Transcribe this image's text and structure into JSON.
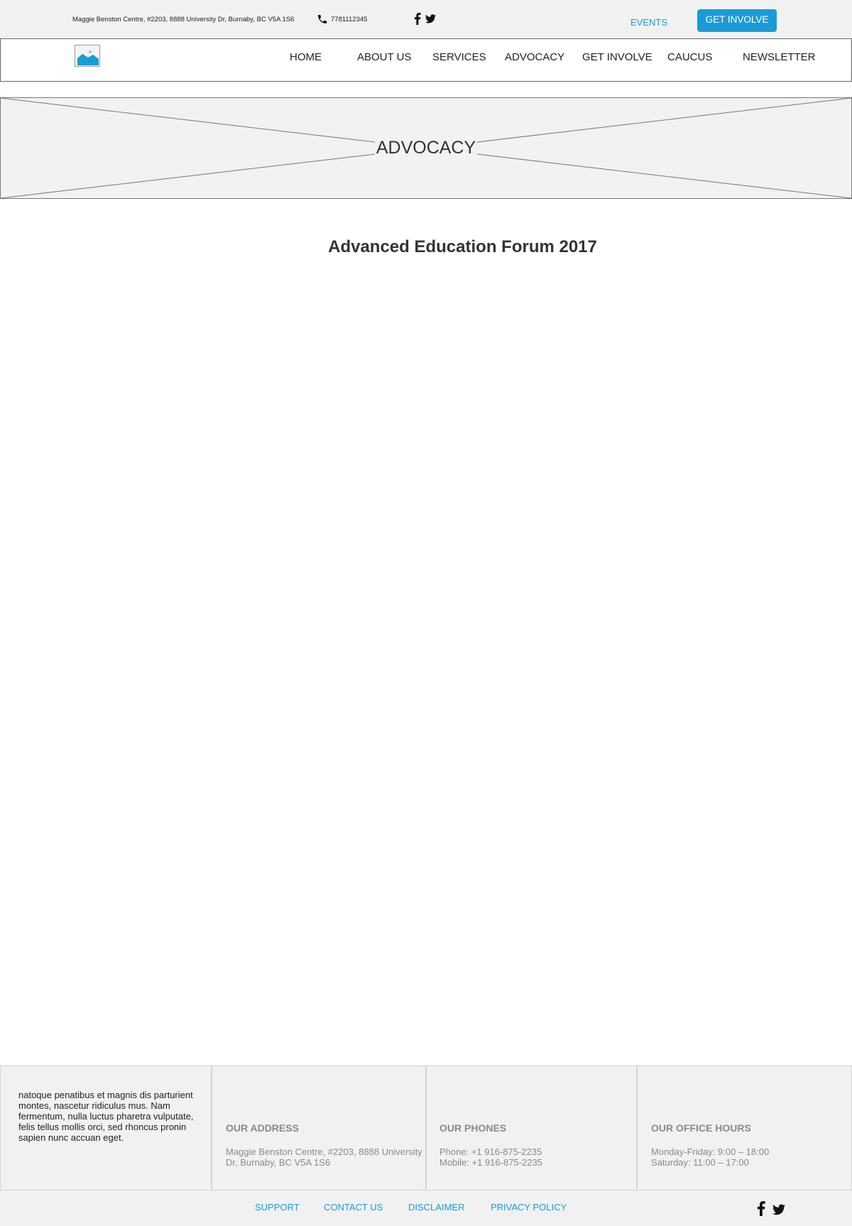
{
  "topbar": {
    "address": "Maggie Benston Centre, #2203, 8888 University Dr, Burnaby, BC V5A 1S6",
    "phone": "7781112345",
    "events_label": "EVENTS",
    "get_involved_label": "GET INVOLVE"
  },
  "nav": {
    "items": [
      {
        "label": "HOME"
      },
      {
        "label": "ABOUT US"
      },
      {
        "label": "SERVICES"
      },
      {
        "label": "ADVOCACY"
      },
      {
        "label": "GET INVOLVE"
      },
      {
        "label": "CAUCUS"
      },
      {
        "label": "NEWSLETTER"
      }
    ]
  },
  "banner": {
    "title": "ADVOCACY"
  },
  "main": {
    "title": "Advanced Education Forum 2017"
  },
  "footer": {
    "about_text": "natoque penatibus et magnis dis parturient montes, nascetur ridiculus mus. Nam fermentum, nulla luctus pharetra vulputate, felis tellus mollis orci, sed rhoncus pronin sapien nunc accuan eget.",
    "address": {
      "heading": "OUR ADDRESS",
      "line1": "Maggie Benston Centre, #2203, 8888 University",
      "line2": "Dr, Burnaby, BC V5A 1S6"
    },
    "phones": {
      "heading": "OUR PHONES",
      "line1": "Phone: +1 916-875-2235",
      "line2": "Mobile: +1 916-875-2235"
    },
    "hours": {
      "heading": "OUR OFFICE HOURS",
      "line1": "Monday-Friday: 9:00 – 18:00",
      "line2": "Saturday: 11:00 – 17:00"
    },
    "links": [
      {
        "label": "SUPPORT"
      },
      {
        "label": "CONTACT US"
      },
      {
        "label": "DISCLAIMER"
      },
      {
        "label": "PRIVACY POLICY"
      }
    ]
  },
  "colors": {
    "accent": "#1a9bd7",
    "bar_background": "#f1f1f1",
    "muted_text": "#8a8a8a"
  },
  "icons": {
    "phone": "phone-icon",
    "facebook": "facebook-icon",
    "twitter": "twitter-icon",
    "logo": "image-placeholder-icon"
  }
}
